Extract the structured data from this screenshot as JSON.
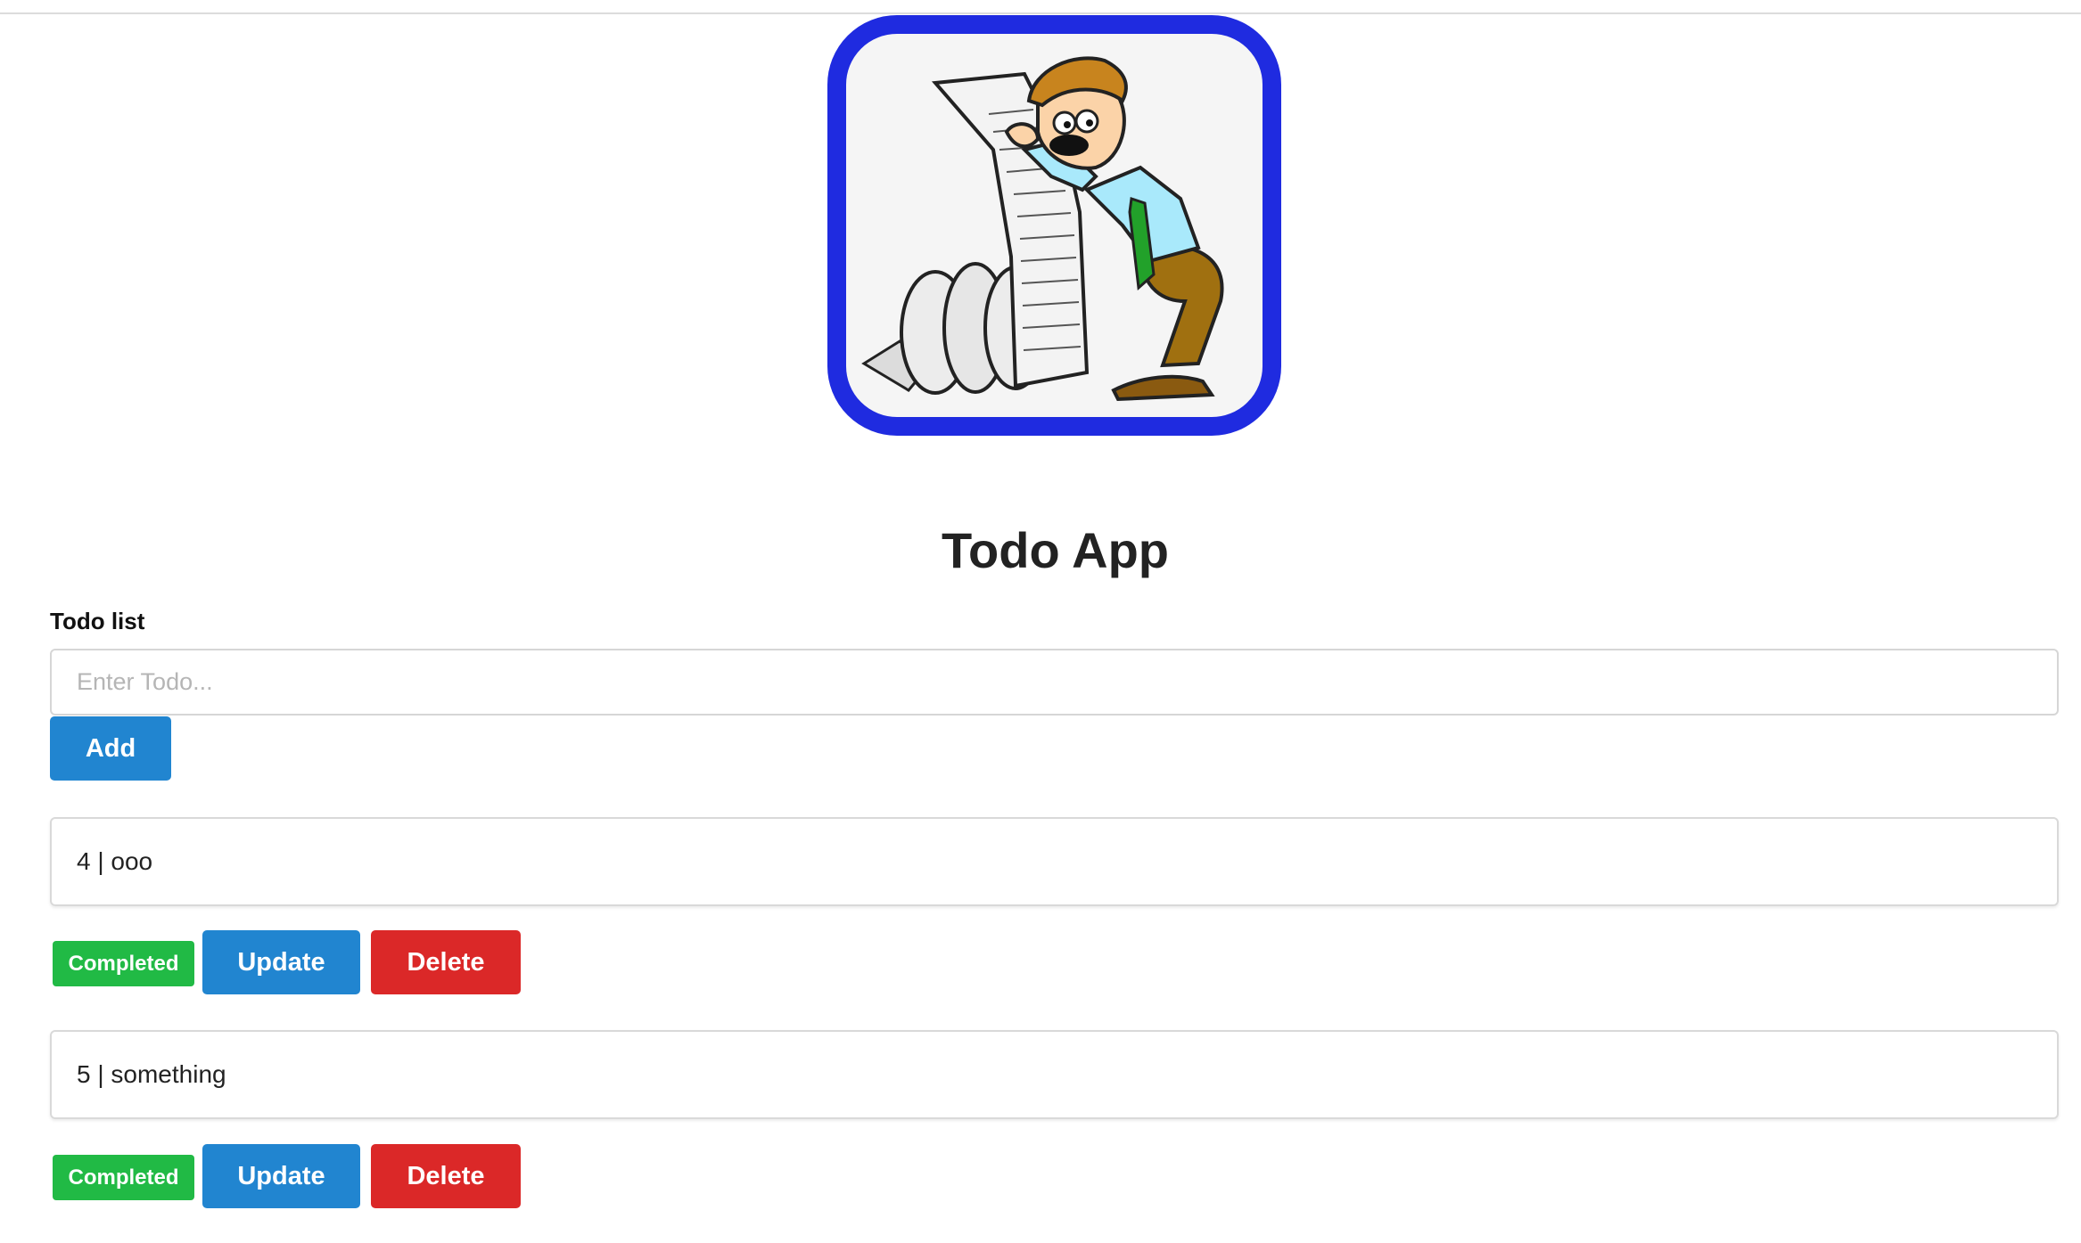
{
  "app": {
    "title": "Todo App",
    "logo_icon": "todo-list-cartoon-logo",
    "accent_color": "#1f2be0"
  },
  "form": {
    "label": "Todo list",
    "placeholder": "Enter Todo...",
    "value": "",
    "add_label": "Add"
  },
  "todos": [
    {
      "text": "4 | ooo",
      "completed_label": "Completed",
      "update_label": "Update",
      "delete_label": "Delete"
    },
    {
      "text": "5 | something",
      "completed_label": "Completed",
      "update_label": "Update",
      "delete_label": "Delete"
    }
  ],
  "colors": {
    "primary": "#2185d0",
    "danger": "#db2828",
    "success": "#21ba45"
  }
}
